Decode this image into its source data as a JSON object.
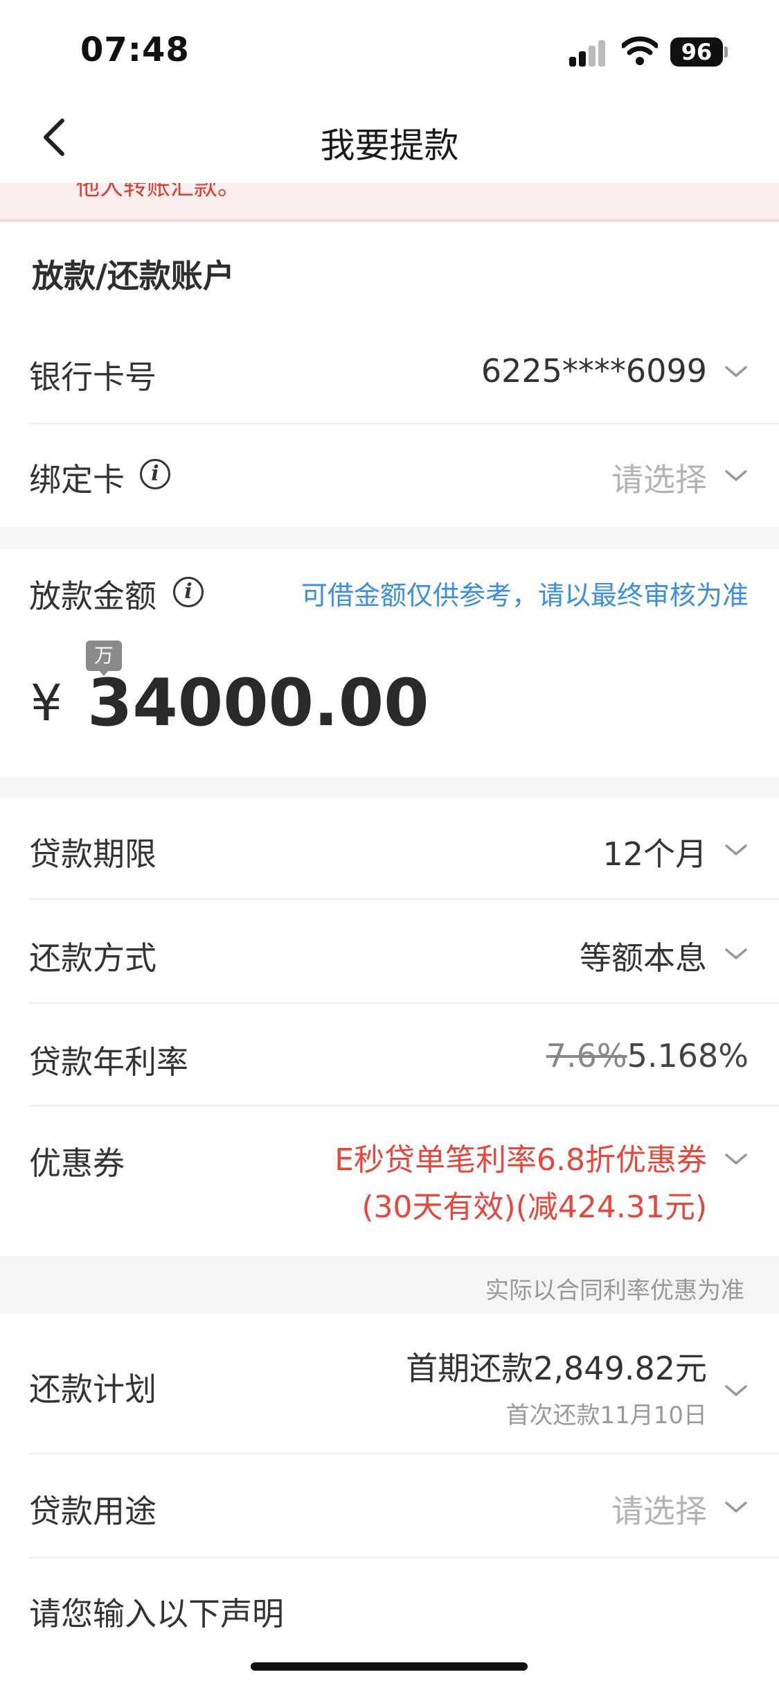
{
  "status_bar": {
    "time": "07:48",
    "battery": "96",
    "signal_icon": "signal-bars-icon",
    "wifi_icon": "wifi-icon"
  },
  "nav": {
    "title": "我要提款",
    "back_icon": "chevron-left-icon"
  },
  "notice": {
    "text": "他人转账汇款。"
  },
  "account_section": {
    "title": "放款/还款账户",
    "bank_card_label": "银行卡号",
    "bank_card_value": "6225****6099",
    "bind_card_label": "绑定卡",
    "bind_card_placeholder": "请选择"
  },
  "amount_section": {
    "label": "放款金额",
    "hint": "可借金额仅供参考，请以最终审核为准",
    "unit_badge": "万",
    "currency": "¥",
    "amount": "34000.00"
  },
  "loan_details": {
    "term_label": "贷款期限",
    "term_value": "12个月",
    "repay_method_label": "还款方式",
    "repay_method_value": "等额本息",
    "rate_label": "贷款年利率",
    "rate_old": "7.6%",
    "rate_new": "5.168%",
    "coupon_label": "优惠券",
    "coupon_line1": "E秒贷单笔利率6.8折优惠券",
    "coupon_line2": "(30天有效)(减424.31元)",
    "rate_note": "实际以合同利率优惠为准"
  },
  "plan_section": {
    "plan_label": "还款计划",
    "first_payment": "首期还款2,849.82元",
    "first_date": "首次还款11月10日",
    "purpose_label": "贷款用途",
    "purpose_placeholder": "请选择",
    "declaration_label": "请您输入以下声明"
  },
  "colors": {
    "accent_red": "#e8463a",
    "link_blue": "#3a8ee6",
    "notice_bg": "#fdeeee"
  }
}
